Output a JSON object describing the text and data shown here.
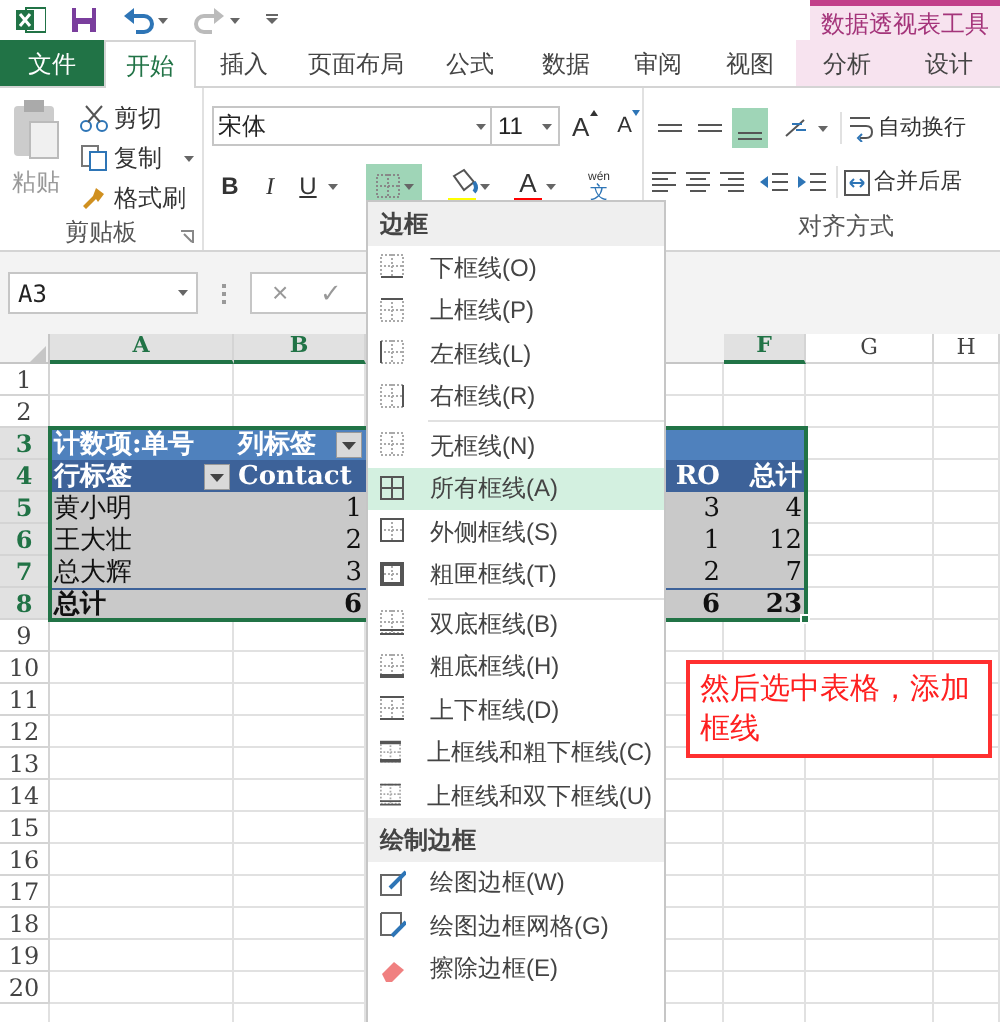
{
  "context_tools": {
    "label": "数据透视表工具"
  },
  "tabs": [
    {
      "label": "文件",
      "kind": "file",
      "selected": false
    },
    {
      "label": "开始",
      "kind": "normal",
      "selected": true
    },
    {
      "label": "插入",
      "kind": "normal",
      "selected": false
    },
    {
      "label": "页面布局",
      "kind": "normal",
      "selected": false
    },
    {
      "label": "公式",
      "kind": "normal",
      "selected": false
    },
    {
      "label": "数据",
      "kind": "normal",
      "selected": false
    },
    {
      "label": "审阅",
      "kind": "normal",
      "selected": false
    },
    {
      "label": "视图",
      "kind": "normal",
      "selected": false
    },
    {
      "label": "分析",
      "kind": "context",
      "selected": false
    },
    {
      "label": "设计",
      "kind": "context",
      "selected": false
    }
  ],
  "clipboard": {
    "paste": "粘贴",
    "cut": "剪切",
    "copy": "复制",
    "format_painter": "格式刷",
    "group_label": "剪贴板"
  },
  "font": {
    "name": "宋体",
    "size": "11",
    "grow": "A",
    "shrink": "A",
    "bold": "B",
    "italic": "I",
    "underline": "U",
    "borders_open": true,
    "font_color": "A",
    "phonetic_top": "wén",
    "phonetic_glyph": "文"
  },
  "alignment": {
    "bottom_align_selected": true,
    "wrap": "自动换行",
    "merge": "合并后居",
    "group_label": "对齐方式"
  },
  "formula_bar": {
    "name_box": "A3",
    "cancel": "×",
    "enter": "✓"
  },
  "sheet": {
    "column_headers": [
      {
        "label": "A",
        "selected": true
      },
      {
        "label": "B",
        "selected": true
      },
      {
        "label": "F",
        "selected": true
      },
      {
        "label": "G",
        "selected": false
      },
      {
        "label": "H",
        "selected": false
      }
    ],
    "row_headers": [
      {
        "label": "1",
        "selected": false
      },
      {
        "label": "2",
        "selected": false
      },
      {
        "label": "3",
        "selected": true
      },
      {
        "label": "4",
        "selected": true
      },
      {
        "label": "5",
        "selected": true
      },
      {
        "label": "6",
        "selected": true
      },
      {
        "label": "7",
        "selected": true
      },
      {
        "label": "8",
        "selected": true
      },
      {
        "label": "9",
        "selected": false
      },
      {
        "label": "10",
        "selected": false
      },
      {
        "label": "11",
        "selected": false
      },
      {
        "label": "12",
        "selected": false
      },
      {
        "label": "13",
        "selected": false
      },
      {
        "label": "14",
        "selected": false
      },
      {
        "label": "15",
        "selected": false
      },
      {
        "label": "16",
        "selected": false
      },
      {
        "label": "17",
        "selected": false
      },
      {
        "label": "18",
        "selected": false
      },
      {
        "label": "19",
        "selected": false
      },
      {
        "label": "20",
        "selected": false
      }
    ]
  },
  "pivot_table": {
    "rows": [
      {
        "kind": "header_top",
        "a": {
          "text": "计数项:单号"
        },
        "b": {
          "text": "列标签",
          "filter": true
        }
      },
      {
        "kind": "header",
        "a": {
          "text": "行标签",
          "filter": true
        },
        "b": {
          "text": "Contact"
        },
        "e": {
          "text": "RO"
        },
        "f": {
          "text": "总计"
        }
      },
      {
        "kind": "data",
        "a": {
          "text": "黄小明"
        },
        "b": {
          "text": "1"
        },
        "e": {
          "text": "3"
        },
        "f": {
          "text": "4"
        }
      },
      {
        "kind": "data",
        "a": {
          "text": "王大壮"
        },
        "b": {
          "text": "2"
        },
        "e": {
          "text": "1"
        },
        "f": {
          "text": "12"
        }
      },
      {
        "kind": "data",
        "a": {
          "text": "总大辉"
        },
        "b": {
          "text": "3"
        },
        "e": {
          "text": "2"
        },
        "f": {
          "text": "7"
        }
      },
      {
        "kind": "total",
        "a": {
          "text": "总计"
        },
        "b": {
          "text": "6"
        },
        "e": {
          "text": "6"
        },
        "f": {
          "text": "23"
        }
      }
    ]
  },
  "border_menu": [
    {
      "kind": "header",
      "label": "边框"
    },
    {
      "kind": "bottom",
      "label": "下框线(O)",
      "selected": false
    },
    {
      "kind": "top",
      "label": "上框线(P)",
      "selected": false
    },
    {
      "kind": "left",
      "label": "左框线(L)",
      "selected": false
    },
    {
      "kind": "right",
      "label": "右框线(R)",
      "selected": false
    },
    {
      "kind": "separator"
    },
    {
      "kind": "none",
      "label": "无框线(N)",
      "selected": false
    },
    {
      "kind": "all",
      "label": "所有框线(A)",
      "selected": true
    },
    {
      "kind": "outside",
      "label": "外侧框线(S)",
      "selected": false
    },
    {
      "kind": "thickbox",
      "label": "粗匣框线(T)",
      "selected": false
    },
    {
      "kind": "separator"
    },
    {
      "kind": "double",
      "label": "双底框线(B)",
      "selected": false
    },
    {
      "kind": "thickbottom",
      "label": "粗底框线(H)",
      "selected": false
    },
    {
      "kind": "topbottom",
      "label": "上下框线(D)",
      "selected": false
    },
    {
      "kind": "topthick",
      "label": "上框线和粗下框线(C)",
      "selected": false
    },
    {
      "kind": "topdouble",
      "label": "上框线和双下框线(U)",
      "selected": false
    },
    {
      "kind": "header",
      "label": "绘制边框"
    },
    {
      "kind": "draw",
      "label": "绘图边框(W)",
      "selected": false
    },
    {
      "kind": "drawgrid",
      "label": "绘图边框网格(G)",
      "selected": false
    },
    {
      "kind": "erase",
      "label": "擦除边框(E)",
      "selected": false
    }
  ],
  "annotation": {
    "text": "然后选中表格，添加框线"
  }
}
